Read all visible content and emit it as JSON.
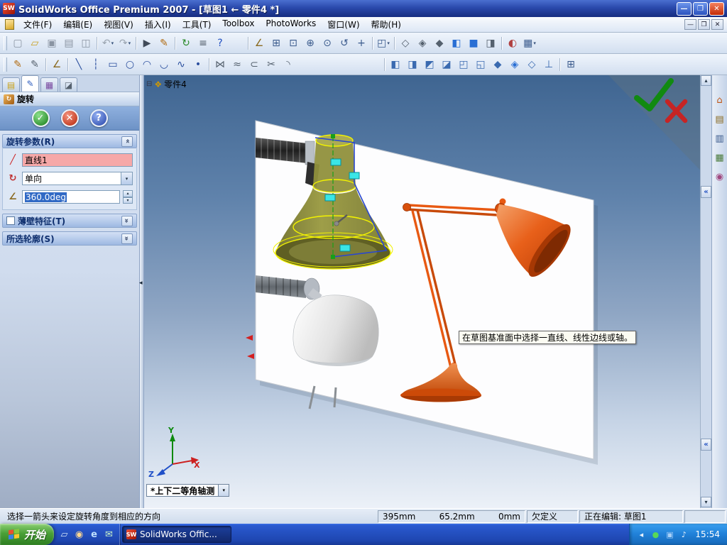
{
  "colors": {
    "selection_pink": "#f6a8a8",
    "selection_blue": "#316ac5",
    "preview_olive": "#8b8b3a",
    "highlight_yellow": "#f2f200",
    "sketch_blue": "#2947cf",
    "centerline_green": "#18a018",
    "handle_cyan": "#3ae6e6",
    "lamp_orange": "#e05510",
    "confirm_green": "#118a11",
    "cancel_red": "#c62424"
  },
  "titlebar": {
    "icon_text": "SW",
    "title": "SolidWorks Office Premium 2007 - [草图1 ← 零件4 *]",
    "minimize": "—",
    "maximize": "❐",
    "close": "✕"
  },
  "menubar": {
    "items": [
      {
        "id": "file",
        "label": "文件(F)"
      },
      {
        "id": "edit",
        "label": "编辑(E)"
      },
      {
        "id": "view",
        "label": "视图(V)"
      },
      {
        "id": "insert",
        "label": "插入(I)"
      },
      {
        "id": "tools",
        "label": "工具(T)"
      },
      {
        "id": "toolbox",
        "label": "Toolbox"
      },
      {
        "id": "photoworks",
        "label": "PhotoWorks"
      },
      {
        "id": "window",
        "label": "窗口(W)"
      },
      {
        "id": "help",
        "label": "帮助(H)"
      }
    ]
  },
  "toolbars": {
    "main": [
      {
        "name": "new-document",
        "glyph": "▢",
        "c": "#8a94a2"
      },
      {
        "name": "open-document",
        "glyph": "▱",
        "c": "#c8a020"
      },
      {
        "name": "save-document",
        "glyph": "▣",
        "c": "#8a94a2"
      },
      {
        "name": "print-document",
        "glyph": "▤",
        "c": "#8a94a2"
      },
      {
        "name": "print-preview",
        "glyph": "◫",
        "c": "#8a94a2"
      },
      {
        "sep": true
      },
      {
        "name": "undo",
        "glyph": "↶",
        "c": "#9aa4b0",
        "drop": true
      },
      {
        "name": "redo",
        "glyph": "↷",
        "c": "#9aa4b0",
        "drop": true
      },
      {
        "sep": true
      },
      {
        "name": "select",
        "glyph": "▶",
        "c": "#404a58"
      },
      {
        "name": "sketch",
        "glyph": "✎",
        "c": "#b06a10"
      },
      {
        "sep": true
      },
      {
        "name": "rebuild",
        "glyph": "↻",
        "c": "#2a8a2a"
      },
      {
        "name": "options",
        "glyph": "≡",
        "c": "#55616e"
      },
      {
        "name": "help",
        "glyph": "?",
        "c": "#2050c0"
      },
      {
        "gap": 24
      },
      {
        "sep": true
      },
      {
        "name": "measure",
        "glyph": "∠",
        "c": "#8a6a20"
      },
      {
        "name": "zoom-to-fit",
        "glyph": "⊞",
        "c": "#3a5a8c"
      },
      {
        "name": "zoom-to-area",
        "glyph": "⊡",
        "c": "#3a5a8c"
      },
      {
        "name": "zoom-in-out",
        "glyph": "⊕",
        "c": "#3a5a8c"
      },
      {
        "name": "zoom-to-selection",
        "glyph": "⊙",
        "c": "#3a5a8c"
      },
      {
        "name": "rotate-view",
        "glyph": "↺",
        "c": "#3a5a8c"
      },
      {
        "name": "pan",
        "glyph": "+",
        "c": "#3a5a8c"
      },
      {
        "sep": true
      },
      {
        "name": "standard-views",
        "glyph": "◰",
        "c": "#3a5a8c",
        "drop": true
      },
      {
        "sep": true
      },
      {
        "name": "wireframe",
        "glyph": "◇",
        "c": "#55616e"
      },
      {
        "name": "hidden-lines-visible",
        "glyph": "◈",
        "c": "#55616e"
      },
      {
        "name": "hidden-lines-removed",
        "glyph": "◆",
        "c": "#55616e"
      },
      {
        "name": "shaded-with-edges",
        "glyph": "◧",
        "c": "#2a6fd4"
      },
      {
        "name": "shaded",
        "glyph": "■",
        "c": "#2a6fd4"
      },
      {
        "name": "shadows-in-shaded-mode",
        "glyph": "◨",
        "c": "#55616e"
      },
      {
        "sep": true
      },
      {
        "name": "section-view",
        "glyph": "◐",
        "c": "#b04040"
      },
      {
        "name": "view-orientation",
        "glyph": "▦",
        "c": "#3a5a8c",
        "drop": true
      }
    ],
    "sketch": [
      {
        "name": "sketch-mode",
        "glyph": "✎",
        "c": "#b06a10"
      },
      {
        "name": "3d-sketch",
        "glyph": "✎",
        "c": "#55616e"
      },
      {
        "sep": true
      },
      {
        "name": "smart-dimension",
        "glyph": "∠",
        "c": "#8a6a20"
      },
      {
        "sep": true
      },
      {
        "name": "line-tool",
        "glyph": "╲",
        "c": "#2a4f9e"
      },
      {
        "name": "centerline-tool",
        "glyph": "┆",
        "c": "#2a4f9e"
      },
      {
        "name": "rectangle-tool",
        "glyph": "▭",
        "c": "#2a4f9e"
      },
      {
        "name": "circle-tool",
        "glyph": "○",
        "c": "#2a4f9e"
      },
      {
        "name": "centerpoint-arc-tool",
        "glyph": "◠",
        "c": "#2a4f9e"
      },
      {
        "name": "tangent-arc-tool",
        "glyph": "◡",
        "c": "#2a4f9e"
      },
      {
        "name": "spline-tool",
        "glyph": "∿",
        "c": "#2a4f9e"
      },
      {
        "name": "point-tool",
        "glyph": "•",
        "c": "#2a4f9e"
      },
      {
        "sep": true
      },
      {
        "name": "mirror-entities",
        "glyph": "⋈",
        "c": "#55616e"
      },
      {
        "name": "offset-entities",
        "glyph": "≈",
        "c": "#55616e"
      },
      {
        "name": "convert-entities",
        "glyph": "⊂",
        "c": "#55616e"
      },
      {
        "name": "trim-entities",
        "glyph": "✂",
        "c": "#55616e"
      },
      {
        "name": "sketch-fillet",
        "glyph": "◝",
        "c": "#55616e"
      },
      {
        "gap": 120
      },
      {
        "sep": true
      },
      {
        "name": "front-view",
        "glyph": "◧",
        "c": "#3a6ab0"
      },
      {
        "name": "back-view",
        "glyph": "◨",
        "c": "#3a6ab0"
      },
      {
        "name": "left-view",
        "glyph": "◩",
        "c": "#3a6ab0"
      },
      {
        "name": "right-view",
        "glyph": "◪",
        "c": "#3a6ab0"
      },
      {
        "name": "top-view",
        "glyph": "◰",
        "c": "#3a6ab0"
      },
      {
        "name": "bottom-view",
        "glyph": "◱",
        "c": "#3a6ab0"
      },
      {
        "name": "isometric-view",
        "glyph": "◆",
        "c": "#3a6ab0"
      },
      {
        "name": "trimetric-view",
        "glyph": "◈",
        "c": "#2a6fd4"
      },
      {
        "name": "dimetric-view",
        "glyph": "◇",
        "c": "#3a6ab0"
      },
      {
        "name": "normal-to-view",
        "glyph": "⊥",
        "c": "#3a6ab0"
      },
      {
        "sep": true
      },
      {
        "name": "full-screen",
        "glyph": "⊞",
        "c": "#3a5a8c"
      }
    ],
    "task_pane": [
      {
        "name": "solidworks-resources",
        "glyph": "⌂",
        "c": "#c05818"
      },
      {
        "name": "design-library",
        "glyph": "▤",
        "c": "#8a6a20"
      },
      {
        "name": "file-explorer",
        "glyph": "▥",
        "c": "#3a5a8c"
      },
      {
        "name": "view-palette",
        "glyph": "▦",
        "c": "#4a7a3a"
      },
      {
        "name": "appearances",
        "glyph": "◉",
        "c": "#a04880"
      }
    ]
  },
  "property_manager": {
    "title": "旋转",
    "ok": "✓",
    "cancel": "✕",
    "help": "?",
    "tabs": [
      {
        "name": "featuremanager-tab",
        "glyph": "▤",
        "c": "#caa21a"
      },
      {
        "name": "propertymanager-tab",
        "glyph": "✎",
        "c": "#2f5fc0",
        "active": true
      },
      {
        "name": "configurationmanager-tab",
        "glyph": "▦",
        "c": "#7a4aa0"
      },
      {
        "name": "dimxpert-tab",
        "glyph": "◪",
        "c": "#55616e"
      }
    ],
    "sections": {
      "parameters": {
        "label": "旋转参数(R)"
      },
      "thin_feature": {
        "label": "薄壁特征(T)",
        "checked": false
      },
      "selected_contours": {
        "label": "所选轮廓(S)"
      }
    },
    "fields": {
      "axis": {
        "value": "直线1"
      },
      "direction": {
        "value": "单向"
      },
      "angle": {
        "value": "360.0deg"
      }
    }
  },
  "graphics_area": {
    "tree_item": "零件4",
    "tooltip": "在草图基准面中选择一直线、线性边线或轴。",
    "view_selector": "*上下二等角轴测",
    "triad": {
      "x": "X",
      "y": "Y",
      "z": "Z"
    }
  },
  "statusbar": {
    "message": "选择一箭头来设定旋转角度到相应的方向",
    "coord_x": "395mm",
    "coord_y": "65.2mm",
    "coord_z": "0mm",
    "state": "欠定义",
    "editing": "正在编辑: 草图1"
  },
  "taskbar": {
    "start_label": "开始",
    "task_button": "SolidWorks Offic...",
    "task_icon_text": "SW",
    "clock": "15:54",
    "quick_launch": [
      {
        "name": "show-desktop",
        "glyph": "▱",
        "c": "#cfe2f8"
      },
      {
        "name": "windows-media-player",
        "glyph": "◉",
        "c": "#ffd890"
      },
      {
        "name": "internet-explorer",
        "glyph": "e",
        "c": "#bfe0ff"
      },
      {
        "name": "outlook-express",
        "glyph": "✉",
        "c": "#c8f0c8"
      }
    ],
    "tray_icons": [
      {
        "name": "tray-hide",
        "glyph": "◂",
        "c": "#e8f2fc"
      },
      {
        "name": "antivirus-tray",
        "glyph": "●",
        "c": "#58d858"
      },
      {
        "name": "input-method-tray",
        "glyph": "▣",
        "c": "#a8d0f8"
      },
      {
        "name": "volume-tray",
        "glyph": "♪",
        "c": "#e8f2fc"
      }
    ]
  },
  "ui": {
    "dropdown_arrow": "▾",
    "combo_arrow": "▾",
    "spin_up": "▴",
    "spin_down": "▾",
    "section_chevron": "«",
    "scroll_up": "▴",
    "scroll_down": "▾",
    "pane_collapse": "«",
    "splitter_arrow": "◂",
    "tree_expand": "⊟",
    "part_glyph": "❖",
    "revolve_glyph": "↻",
    "axis_icon_glyph": "╱",
    "direction_icon_glyph": "↻",
    "angle_icon_glyph": "∠",
    "mdi_min": "—",
    "mdi_restore": "❐",
    "mdi_close": "✕"
  }
}
